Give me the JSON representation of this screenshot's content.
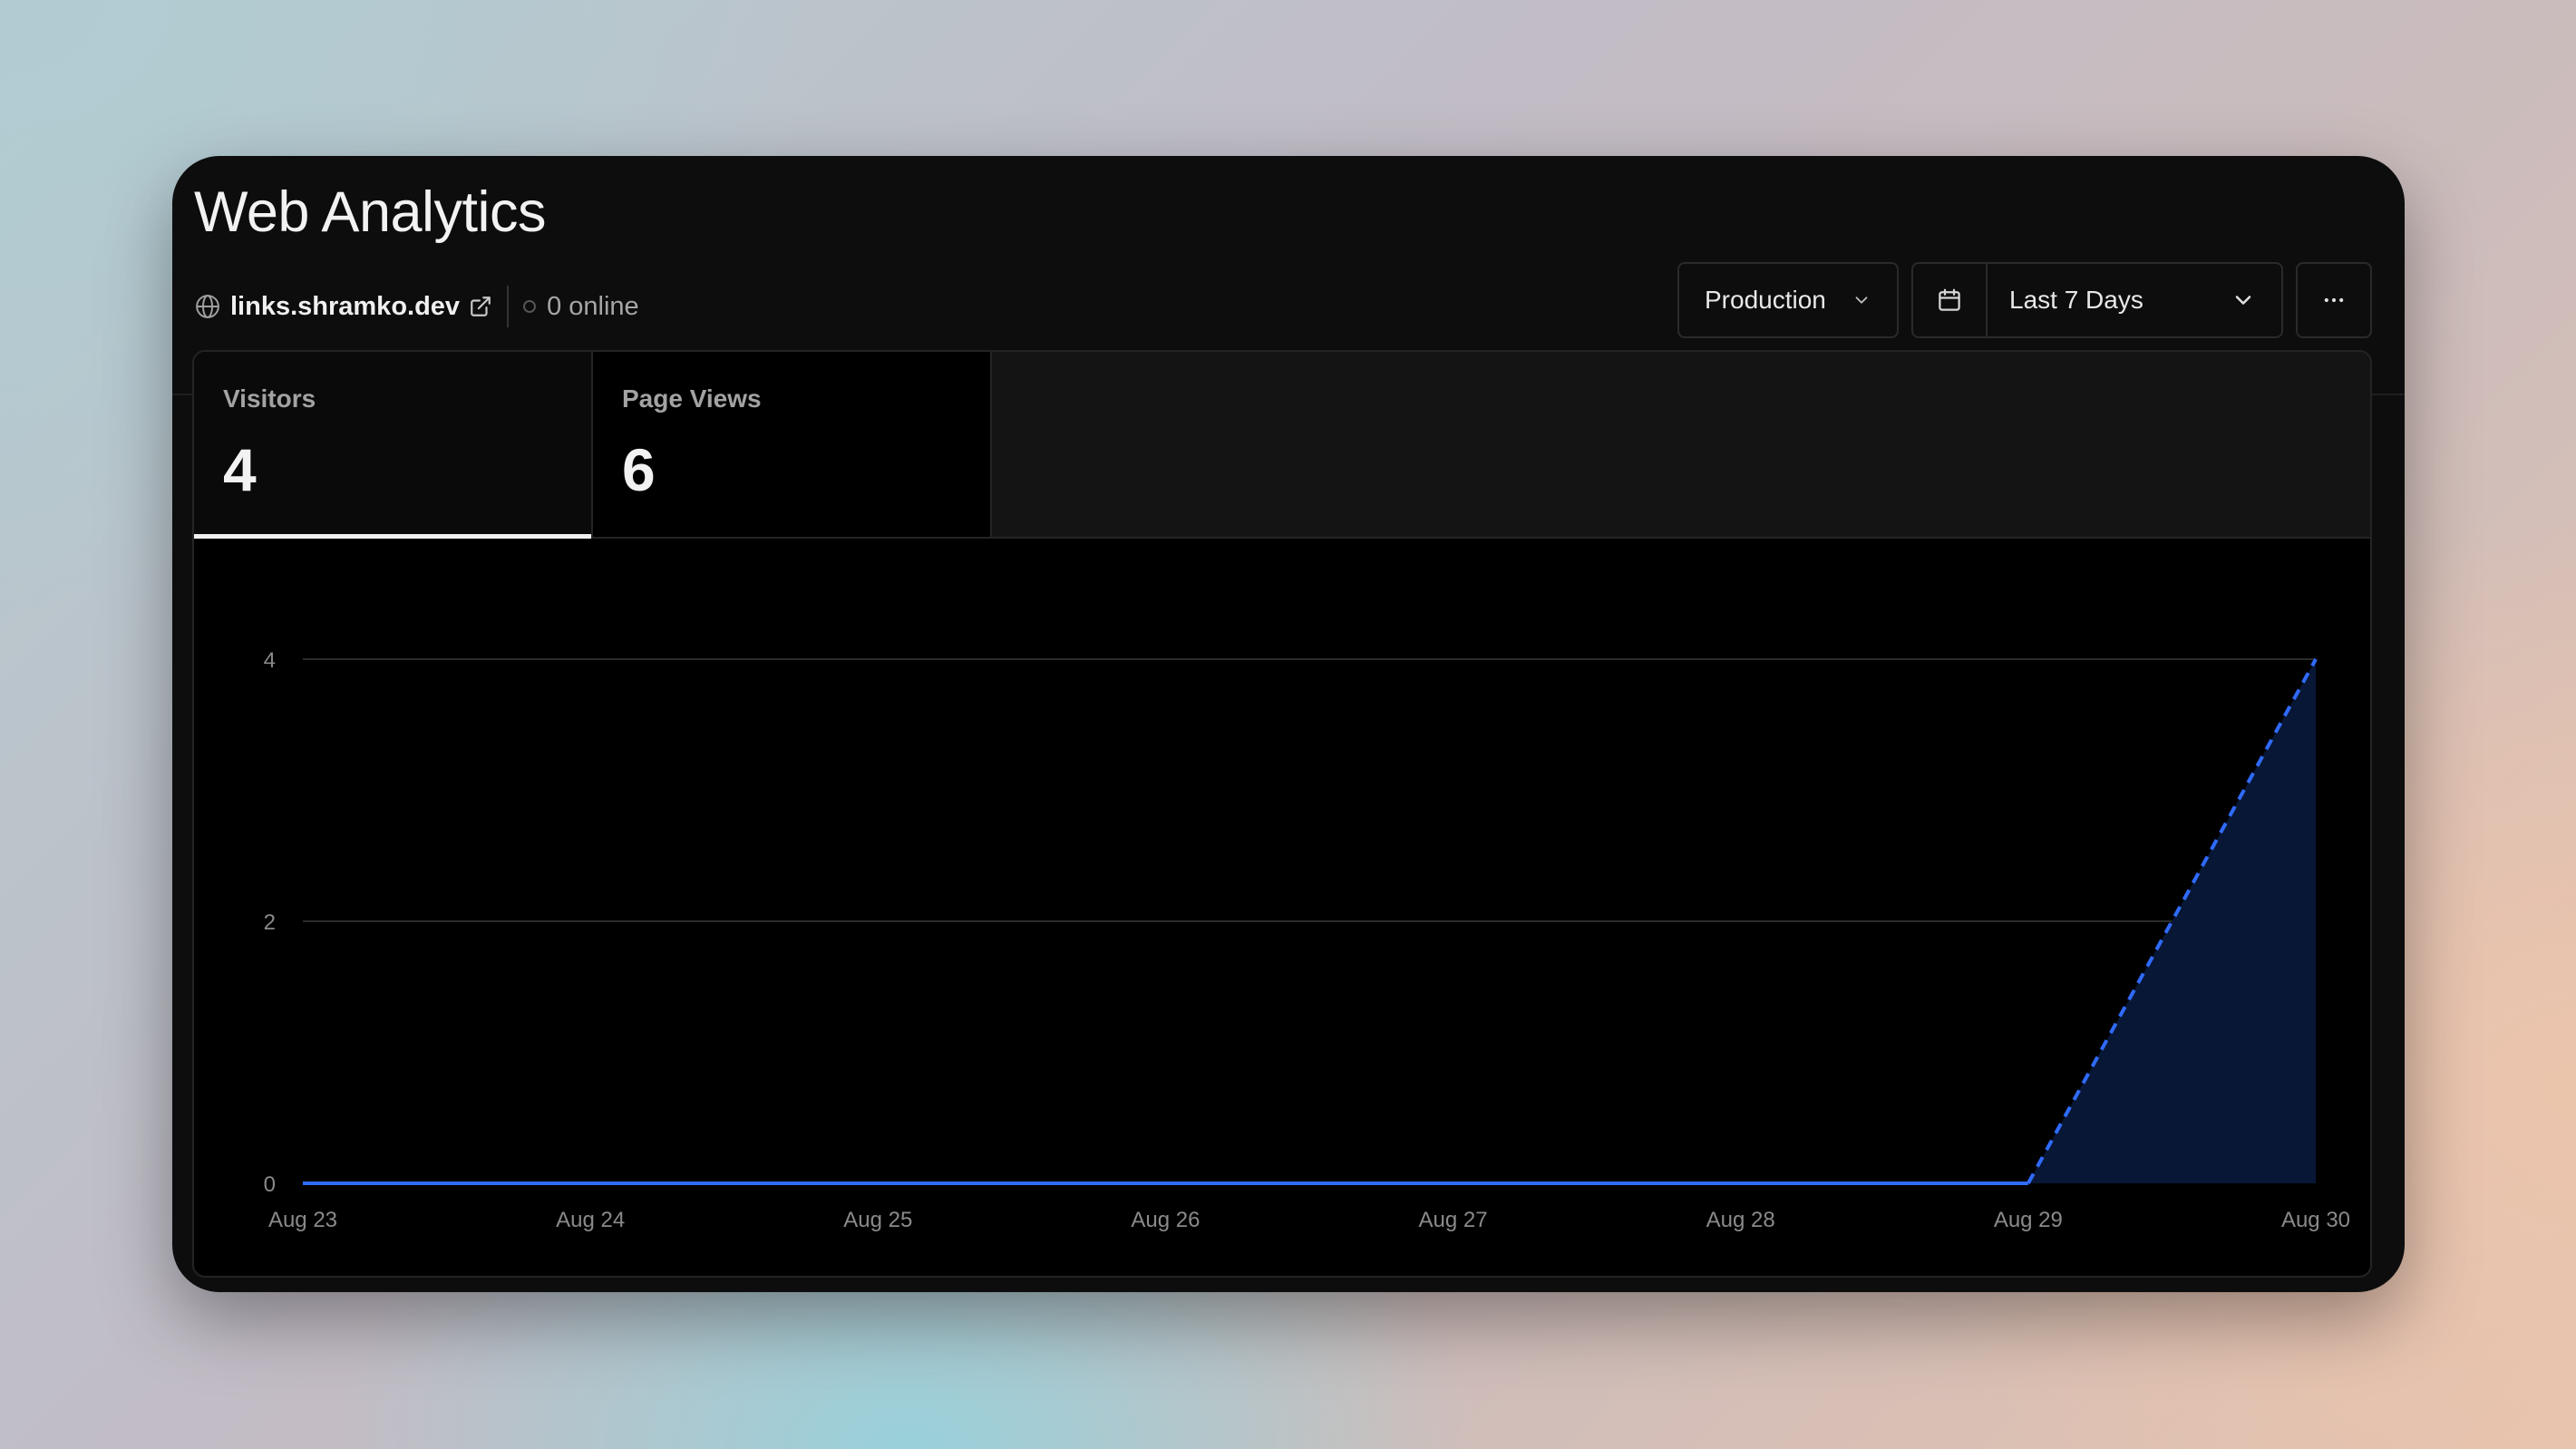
{
  "header": {
    "title": "Web Analytics",
    "site": "links.shramko.dev",
    "online": "0 online"
  },
  "controls": {
    "environment": "Production",
    "date_range": "Last 7 Days",
    "more_icon": "more-horizontal-icon"
  },
  "tabs": [
    {
      "label": "Visitors",
      "value": "4",
      "active": true
    },
    {
      "label": "Page Views",
      "value": "6",
      "active": false
    }
  ],
  "colors": {
    "line": "#2f6bff",
    "area": "#081735"
  },
  "chart_data": {
    "type": "area",
    "series": [
      {
        "values": [
          0,
          0,
          0,
          0,
          0,
          0,
          0,
          4
        ]
      }
    ],
    "x": [
      "Aug 23",
      "Aug 24",
      "Aug 25",
      "Aug 26",
      "Aug 27",
      "Aug 28",
      "Aug 29",
      "Aug 30"
    ],
    "y_ticks": [
      0,
      2,
      4
    ],
    "ylim": [
      0,
      4
    ],
    "dashed_last_segment": true,
    "grid": true
  }
}
